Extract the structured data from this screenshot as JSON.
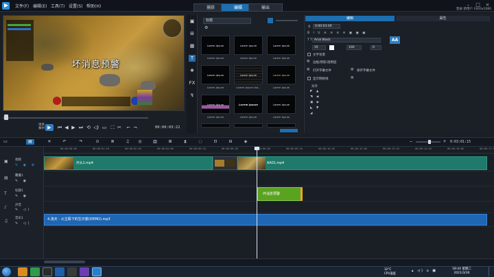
{
  "menu": [
    "文件(F)",
    "编辑(E)",
    "工具(T)",
    "设置(S)",
    "帮助(H)"
  ],
  "modes": [
    {
      "label": "捕获",
      "active": false
    },
    {
      "label": "编辑",
      "active": true
    },
    {
      "label": "输出",
      "active": false
    }
  ],
  "account": {
    "line1": "登录 新用户",
    "line2": "1920x1080"
  },
  "preview": {
    "overlay_text": "坏消息预警",
    "mode_label": "项目 素材"
  },
  "transport": {
    "timecode": "00:00:03:22"
  },
  "library": {
    "dropdown": "标题",
    "thumbs": [
      {
        "text": "Lorem Ipsum",
        "label": "Lorem Ipsum"
      },
      {
        "text": "Lorem Ipsum",
        "label": "Lorem Ipsum"
      },
      {
        "text": "Lorem Ipsum",
        "label": "Lorem Ipsum"
      },
      {
        "text": "Lorem Ipsum",
        "label": "Lorem Ipsum"
      },
      {
        "text": "Lorem Ipsum",
        "label": "Lorem Ipsum dol..."
      },
      {
        "text": "Lorem Ipsum",
        "label": "Lorem Ipsum"
      },
      {
        "text": "Lorem Ipsum",
        "label": "Lorem Ipsum"
      },
      {
        "text": "Lorem Ipsum",
        "label": "Lorem Ipsum"
      },
      {
        "text": "Lorem Ipsum",
        "label": "Lorem Ipsum"
      }
    ]
  },
  "options": {
    "tabs": [
      {
        "label": "编辑",
        "active": true
      },
      {
        "label": "属性",
        "active": false
      }
    ],
    "duration": "0:00:03:00",
    "font": "Arial Black",
    "font_size": "35",
    "line_spacing": "100",
    "angle": "0",
    "checkbox1": "文字背景",
    "checkbox2": "显示网格线",
    "label_border": "边框/阴影/透明度",
    "label_save": "打开字幕文件",
    "label_save2": "保存字幕文件",
    "label_align": "对齐"
  },
  "timeline": {
    "ticks": [
      "00:00:00:00",
      "00:00:01:10",
      "00:00:02:20",
      "00:00:04:00",
      "00:00:05:10",
      "00:00:06:20",
      "00:00:08:00",
      "00:00:09:10",
      "00:00:10:20",
      "00:00:12:00",
      "00:00:13:10",
      "00:00:14:20",
      "00:00:16:00",
      "00:00:17:10",
      "00:00:18:20",
      "00:00:20:00",
      "00:00:21:10",
      "00:00:22:20",
      "00:00:24:00",
      "00:00:25:10"
    ],
    "duration": "0:03:01:15",
    "tracks": [
      {
        "name": "视频"
      },
      {
        "name": "覆叠1"
      },
      {
        "name": "标题1"
      },
      {
        "name": "声音"
      },
      {
        "name": "音乐1"
      }
    ],
    "video_clip1": "开头1.mp4",
    "video_clip2": "AA01.mp4",
    "title_clip": "坏消息预警",
    "audio_clip": "4.洛天 - 公主殿下的生日宴(DEMO).mp3"
  },
  "taskbar": {
    "tray_line1": "32°C",
    "tray_line2": "CPU温度",
    "time": "18:44 星期二",
    "date": "2021/3/30"
  }
}
